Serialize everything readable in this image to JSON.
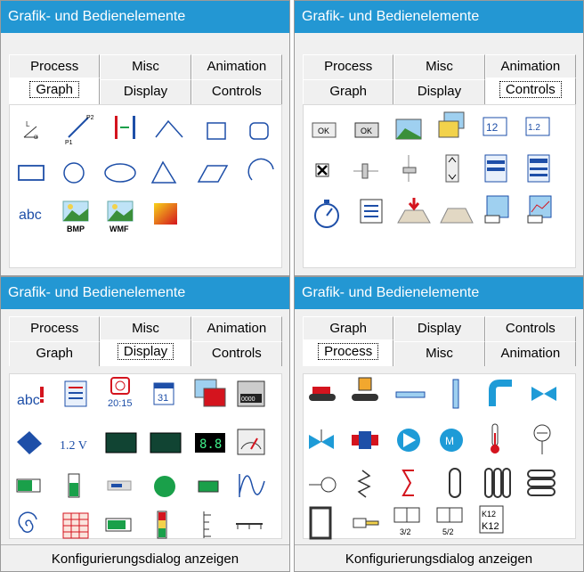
{
  "panel_title": "Grafik- und Bedienelemente",
  "tabs": {
    "process": "Process",
    "misc": "Misc",
    "animation": "Animation",
    "graph": "Graph",
    "display": "Display",
    "controls": "Controls"
  },
  "footer_button": "Konfigurierungsdialog anzeigen",
  "graph_icons": {
    "text_sample": "abc",
    "bmp_label": "BMP",
    "wmf_label": "WMF"
  },
  "controls_icons": {
    "ok_label": "OK",
    "num_field": "12",
    "spin_field": "1.2"
  },
  "display_icons": {
    "text_sample": "abc",
    "time_label": "20:15",
    "calendar_day": "31",
    "voltage_label": "1.2 V",
    "seven_seg": "8.8",
    "lcd_digits": "0000"
  },
  "process_icons": {
    "valve_a": "3/2",
    "valve_b": "5/2",
    "k12_top": "K12",
    "k12_bottom": "K12"
  },
  "colors": {
    "title_bar": "#2397d3",
    "icon_blue": "#1e4fa8",
    "icon_red": "#d4141e"
  }
}
